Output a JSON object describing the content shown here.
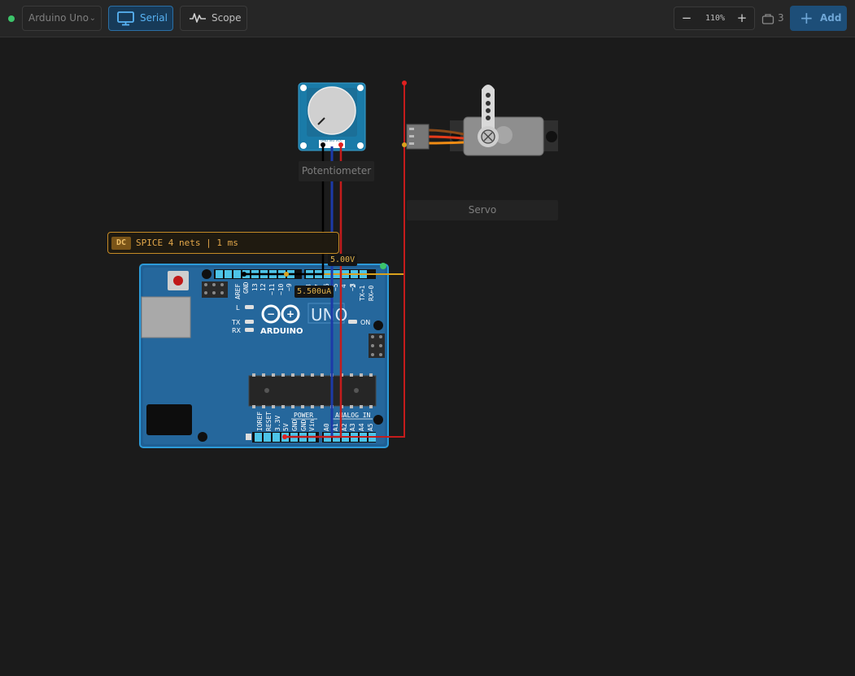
{
  "toolbar": {
    "board": "Arduino Uno",
    "serial_label": "Serial",
    "scope_label": "Scope",
    "zoom_out": "−",
    "zoom_level": "110%",
    "zoom_in": "+",
    "parts_count": "3",
    "add_label": "Add",
    "accent_color": "#58b3f4",
    "status_color": "#3cc46a"
  },
  "canvas": {
    "spice_badge": "DC",
    "spice_status": "SPICE 4 nets | 1 ms",
    "probe_voltage": "5.00V",
    "probe_current": "5.500uA",
    "potentiometer_label": "Potentiometer",
    "servo_label": "Servo"
  },
  "arduino": {
    "brand": "ARDUINO",
    "model": "UNO",
    "on_label": "ON",
    "l_label": "L",
    "tx_label": "TX",
    "rx_label": "RX",
    "power_header": "POWER",
    "analog_header": "ANALOG IN",
    "digital_pins": [
      "AREF",
      "GND",
      "13",
      "12",
      "~11",
      "~10",
      "~9",
      "8",
      "7",
      "~6",
      "~5",
      "4",
      "~3",
      "2",
      "TX→1",
      "RX←0"
    ],
    "power_pins": [
      "IOREF",
      "RESET",
      "3.3V",
      "5V",
      "GND",
      "GND",
      "Vin"
    ],
    "analog_pins": [
      "A0",
      "A1",
      "A2",
      "A3",
      "A4",
      "A5"
    ],
    "pot_pins": "GND SIG VCC"
  }
}
